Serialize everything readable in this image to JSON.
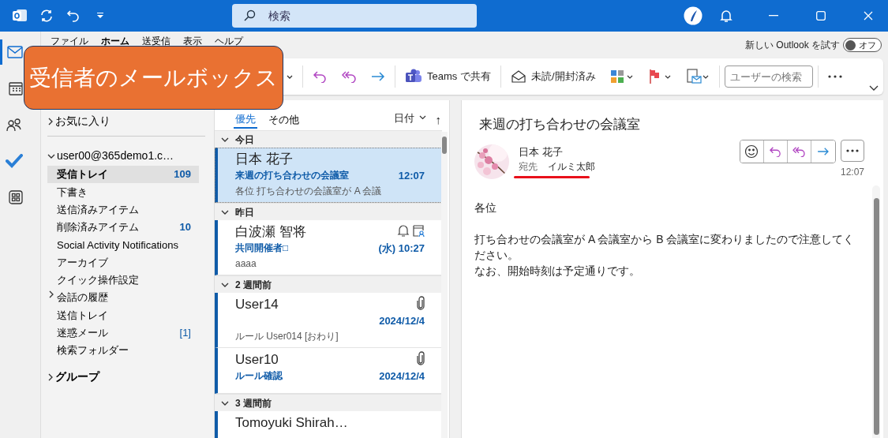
{
  "title_bar": {
    "search_placeholder": "検索"
  },
  "ribbon_tabs": [
    {
      "label": "ファイル",
      "selected": false
    },
    {
      "label": "ホーム",
      "selected": true
    },
    {
      "label": "送受信",
      "selected": false
    },
    {
      "label": "表示",
      "selected": false
    },
    {
      "label": "ヘルプ",
      "selected": false
    }
  ],
  "new_outlook": {
    "label": "新しい Outlook を試す",
    "on": false,
    "toggle_label": "オフ"
  },
  "ribbon": {
    "teams_share": "Teams で共有",
    "read_unread": "未読/開封済み",
    "people_search_placeholder": "ユーザーの検索"
  },
  "callout": "受信者のメールボックス",
  "nav_rail": [
    {
      "kind": "mail",
      "selected": true
    },
    {
      "kind": "calendar",
      "selected": false
    },
    {
      "kind": "people",
      "selected": false
    },
    {
      "kind": "todo",
      "selected": false
    },
    {
      "kind": "apps",
      "selected": false
    }
  ],
  "folder_pane": [
    {
      "label": "お気に入り",
      "bold": false,
      "expanded": false
    },
    {
      "label": "user00@365demo1.c…",
      "bold": false,
      "expanded": true,
      "children": [
        {
          "label": "受信トレイ",
          "count": "109",
          "selected": true,
          "bold": true
        },
        {
          "label": "下書き",
          "selected": false,
          "bold": false
        },
        {
          "label": "送信済みアイテム",
          "selected": false,
          "bold": false
        },
        {
          "label": "削除済みアイテム",
          "count": "10",
          "selected": false,
          "bold": false
        },
        {
          "label": "Social Activity Notifications",
          "selected": false,
          "bold": false
        },
        {
          "label": "アーカイブ",
          "selected": false,
          "bold": false
        },
        {
          "label": "クイック操作設定",
          "selected": false,
          "bold": false
        },
        {
          "label": "会話の履歴",
          "selected": false,
          "bold": false,
          "expanded": false
        },
        {
          "label": "送信トレイ",
          "selected": false,
          "bold": false
        },
        {
          "label": "迷惑メール",
          "count": "[1]",
          "selected": false,
          "bold": false
        },
        {
          "label": "検索フォルダー",
          "selected": false,
          "bold": false
        }
      ]
    },
    {
      "label": "グループ",
      "bold": true,
      "expanded": false
    }
  ],
  "message_list": {
    "tabs": [
      {
        "label": "優先",
        "selected": true
      },
      {
        "label": "その他",
        "selected": false
      }
    ],
    "sort": "日付",
    "sort_arrow": "↑",
    "groups": [
      {
        "label": "今日",
        "expanded": true,
        "messages": [
          {
            "sender": "日本 花子",
            "subject": "来週の打ち合わせの会議室",
            "time": "12:07",
            "preview": "各位  打ち合わせの会議室が A 会議",
            "unread": true,
            "selected": true
          }
        ]
      },
      {
        "label": "昨日",
        "expanded": true,
        "messages": [
          {
            "sender": "白波瀬 智将",
            "subject": "共同開催者□",
            "time": "(水) 10:27",
            "preview": "aaaa",
            "unread": true,
            "selected": false,
            "icons": [
              {
                "kind": "bell"
              },
              {
                "kind": "meeting"
              }
            ]
          }
        ]
      },
      {
        "label": "2 週間前",
        "expanded": true,
        "messages": [
          {
            "sender": "User14",
            "time": "2024/12/4",
            "preview": "ルール  User014 [おわり]",
            "unread": true,
            "selected": false,
            "icons": [
              {
                "kind": "attachment"
              }
            ]
          },
          {
            "sender": "User10",
            "subject": "ルール確認",
            "time": "2024/12/4",
            "unread": true,
            "selected": false,
            "icons": [
              {
                "kind": "attachment"
              }
            ]
          }
        ]
      },
      {
        "label": "3 週間前",
        "expanded": true,
        "messages": [
          {
            "sender": "Tomoyuki Shirah…",
            "unread": true,
            "selected": false
          }
        ]
      }
    ]
  },
  "reading_pane": {
    "subject": "来週の打ち合わせの会議室",
    "sender": "日本 花子",
    "to_label": "宛先",
    "to": "イルミ太郎",
    "time": "12:07",
    "highlight_recipient": true,
    "body": [
      [
        "各位"
      ],
      [
        "打ち合わせの会議室が A 会議室から B 会議室に変わりましたので注意してください。",
        "なお、開始時刻は予定通りです。"
      ]
    ]
  }
}
